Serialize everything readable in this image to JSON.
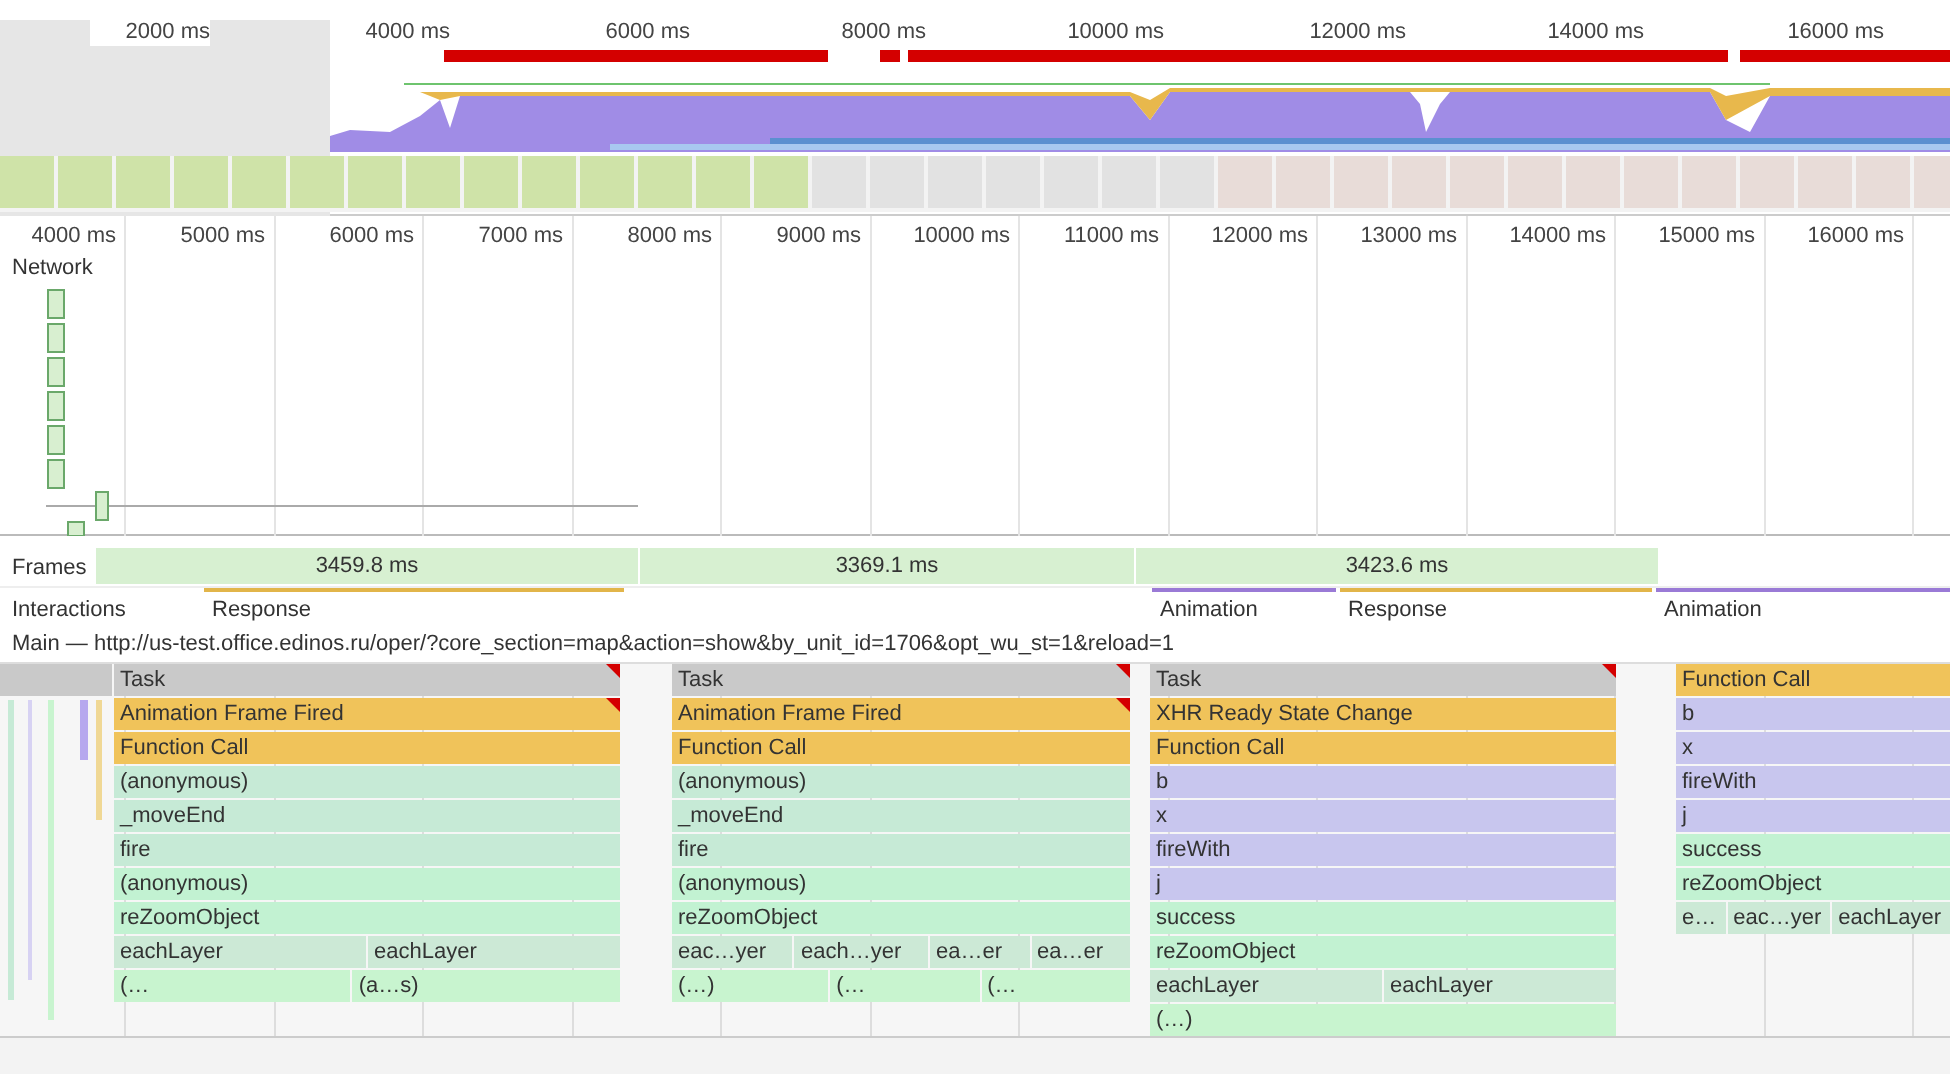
{
  "overview": {
    "ticks": [
      "2000 ms",
      "4000 ms",
      "6000 ms",
      "8000 ms",
      "10000 ms",
      "12000 ms",
      "14000 ms",
      "16000 ms"
    ]
  },
  "ruler": {
    "ticks": [
      "4000 ms",
      "5000 ms",
      "6000 ms",
      "7000 ms",
      "8000 ms",
      "9000 ms",
      "10000 ms",
      "11000 ms",
      "12000 ms",
      "13000 ms",
      "14000 ms",
      "15000 ms",
      "16000 ms"
    ]
  },
  "network": {
    "label": "Network"
  },
  "frames": {
    "label": "Frames",
    "segments": [
      "3459.8 ms",
      "3369.1 ms",
      "3423.6 ms"
    ]
  },
  "interactions": {
    "label": "Interactions",
    "items": [
      {
        "label": "Response",
        "color": "#e2b54a"
      },
      {
        "label": "Animation",
        "color": "#9a7ad6"
      },
      {
        "label": "Response",
        "color": "#e2b54a"
      },
      {
        "label": "Animation",
        "color": "#9a7ad6"
      }
    ]
  },
  "main": {
    "title": "Main — http://us-test.office.edinos.ru/oper/?core_section=map&action=show&by_unit_id=1706&opt_wu_st=1&reload=1",
    "columns": [
      {
        "blocks": [
          {
            "labels": [
              "Task"
            ],
            "color": "#c9c9c9",
            "warning": true
          },
          {
            "labels": [
              "Animation Frame Fired"
            ],
            "color": "#f0c35a",
            "warning": true
          },
          {
            "labels": [
              "Function Call"
            ],
            "color": "#f0c35a",
            "warning": false
          },
          {
            "labels": [
              "(anonymous)"
            ],
            "color": "#c6ead6",
            "warning": false
          },
          {
            "labels": [
              "_moveEnd"
            ],
            "color": "#c6ead6",
            "warning": false
          },
          {
            "labels": [
              "fire"
            ],
            "color": "#c6ead6",
            "warning": false
          },
          {
            "labels": [
              "(anonymous)"
            ],
            "color": "#c2f2d2",
            "warning": false
          },
          {
            "labels": [
              "reZoomObject"
            ],
            "color": "#c2f2d2",
            "warning": false
          },
          {
            "labels": [
              "eachLayer",
              "eachLayer"
            ],
            "color": "#cce9d6",
            "warning": false
          },
          {
            "labels": [
              "(…",
              "(a…s)"
            ],
            "color": "#c8f4cf",
            "warning": false
          }
        ]
      },
      {
        "blocks": [
          {
            "labels": [
              "Task"
            ],
            "color": "#c9c9c9",
            "warning": true
          },
          {
            "labels": [
              "Animation Frame Fired"
            ],
            "color": "#f0c35a",
            "warning": true
          },
          {
            "labels": [
              "Function Call"
            ],
            "color": "#f0c35a",
            "warning": false
          },
          {
            "labels": [
              "(anonymous)"
            ],
            "color": "#c6ead6",
            "warning": false
          },
          {
            "labels": [
              "_moveEnd"
            ],
            "color": "#c6ead6",
            "warning": false
          },
          {
            "labels": [
              "fire"
            ],
            "color": "#c6ead6",
            "warning": false
          },
          {
            "labels": [
              "(anonymous)"
            ],
            "color": "#c2f2d2",
            "warning": false
          },
          {
            "labels": [
              "reZoomObject"
            ],
            "color": "#c2f2d2",
            "warning": false
          },
          {
            "labels": [
              "eac…yer",
              "each…yer",
              "ea…er",
              "ea…er"
            ],
            "color": "#cce9d6",
            "warning": false
          },
          {
            "labels": [
              "(…)",
              "(…",
              "(…"
            ],
            "color": "#c8f4cf",
            "warning": false
          }
        ]
      },
      {
        "blocks": [
          {
            "labels": [
              "Task"
            ],
            "color": "#c9c9c9",
            "warning": true
          },
          {
            "labels": [
              "XHR Ready State Change"
            ],
            "color": "#f0c35a",
            "warning": false
          },
          {
            "labels": [
              "Function Call"
            ],
            "color": "#f0c35a",
            "warning": false
          },
          {
            "labels": [
              "b"
            ],
            "color": "#c8c6ee",
            "warning": false
          },
          {
            "labels": [
              "x"
            ],
            "color": "#c8c6ee",
            "warning": false
          },
          {
            "labels": [
              "fireWith"
            ],
            "color": "#c8c6ee",
            "warning": false
          },
          {
            "labels": [
              "j"
            ],
            "color": "#c8c6ee",
            "warning": false
          },
          {
            "labels": [
              "success"
            ],
            "color": "#c2f2d2",
            "warning": false
          },
          {
            "labels": [
              "reZoomObject"
            ],
            "color": "#c2f2d2",
            "warning": false
          },
          {
            "labels": [
              "eachLayer",
              "eachLayer"
            ],
            "color": "#cce9d6",
            "warning": false
          },
          {
            "labels": [
              "(…)"
            ],
            "color": "#c8f4cf",
            "warning": false
          }
        ]
      },
      {
        "blocks": [
          {
            "labels": [
              "Function Call"
            ],
            "color": "#f0c35a",
            "warning": false
          },
          {
            "labels": [
              "b"
            ],
            "color": "#c8c6ee",
            "warning": false
          },
          {
            "labels": [
              "x"
            ],
            "color": "#c8c6ee",
            "warning": false
          },
          {
            "labels": [
              "fireWith"
            ],
            "color": "#c8c6ee",
            "warning": false
          },
          {
            "labels": [
              "j"
            ],
            "color": "#c8c6ee",
            "warning": false
          },
          {
            "labels": [
              "success"
            ],
            "color": "#c2f2d2",
            "warning": false
          },
          {
            "labels": [
              "reZoomObject"
            ],
            "color": "#c2f2d2",
            "warning": false
          },
          {
            "labels": [
              "e…",
              "eac…yer",
              "eachLayer"
            ],
            "color": "#cce9d6",
            "warning": false
          }
        ]
      }
    ]
  }
}
